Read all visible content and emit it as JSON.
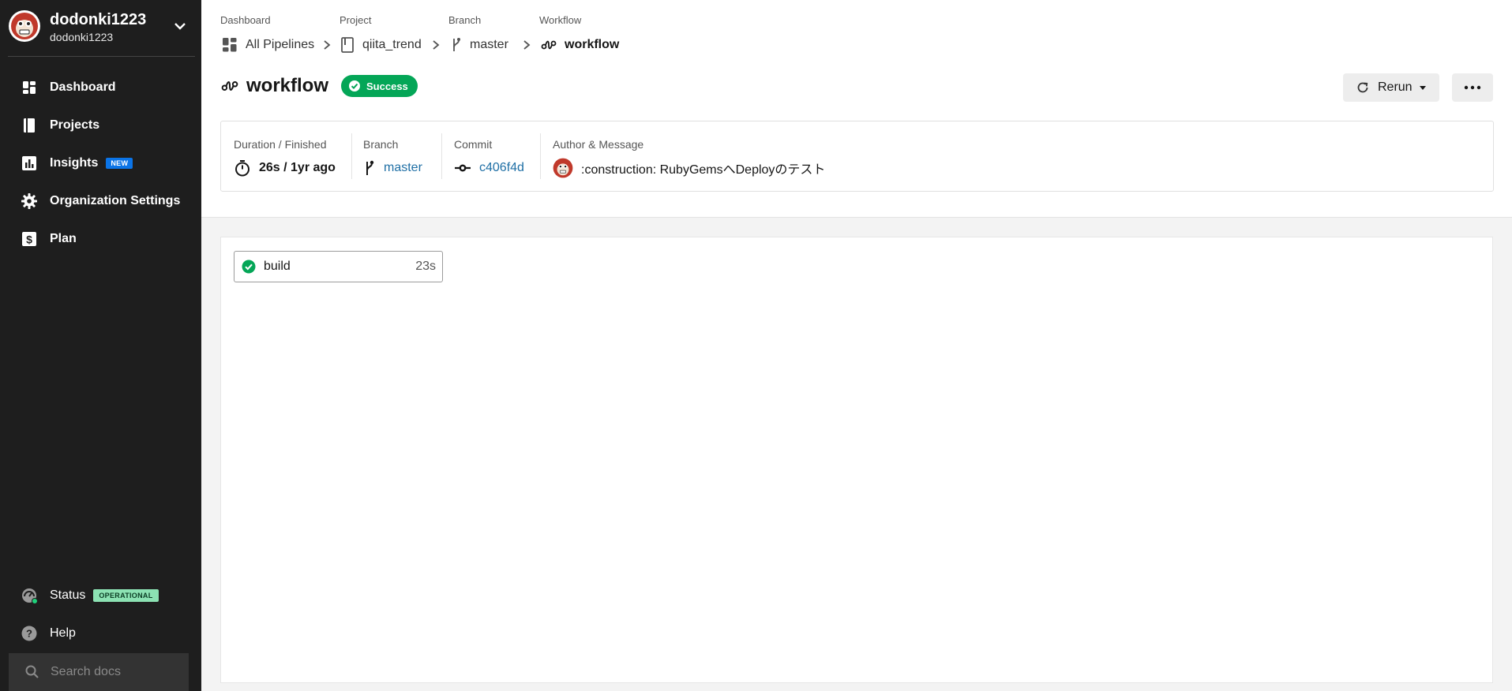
{
  "sidebar": {
    "org_name": "dodonki1223",
    "org_sub": "dodonki1223",
    "items": [
      {
        "label": "Dashboard"
      },
      {
        "label": "Projects"
      },
      {
        "label": "Insights",
        "badge": "NEW"
      },
      {
        "label": "Organization Settings"
      },
      {
        "label": "Plan"
      }
    ],
    "status": {
      "label": "Status",
      "badge": "OPERATIONAL"
    },
    "help": {
      "label": "Help"
    },
    "search": {
      "placeholder": "Search docs"
    }
  },
  "breadcrumbs": [
    {
      "label": "Dashboard",
      "value": "All Pipelines",
      "icon": "dashboard-icon"
    },
    {
      "label": "Project",
      "value": "qiita_trend",
      "icon": "project-icon"
    },
    {
      "label": "Branch",
      "value": "master",
      "icon": "branch-icon"
    },
    {
      "label": "Workflow",
      "value": "workflow",
      "icon": "workflow-icon"
    }
  ],
  "page": {
    "title": "workflow",
    "status": "Success",
    "rerun_label": "Rerun"
  },
  "meta": {
    "duration": {
      "label": "Duration / Finished",
      "value": "26s / 1yr ago"
    },
    "branch": {
      "label": "Branch",
      "value": "master"
    },
    "commit": {
      "label": "Commit",
      "value": "c406f4d"
    },
    "author": {
      "label": "Author & Message",
      "value": ":construction: RubyGemsへDeployのテスト"
    }
  },
  "jobs": [
    {
      "name": "build",
      "duration": "23s",
      "status": "success"
    }
  ],
  "colors": {
    "sidebar_bg": "#1e1e1e",
    "success": "#04a657",
    "link": "#1f6fa5",
    "badge_new": "#0b74e7",
    "badge_operational": "#8ce2b3"
  }
}
